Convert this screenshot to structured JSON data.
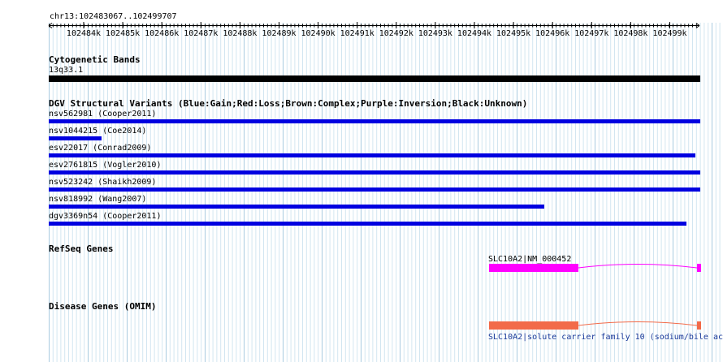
{
  "ruler": {
    "location": "chr13:102483067..102499707",
    "ticks": [
      "102484k",
      "102485k",
      "102486k",
      "102487k",
      "102488k",
      "102489k",
      "102490k",
      "102491k",
      "102492k",
      "102493k",
      "102494k",
      "102495k",
      "102496k",
      "102497k",
      "102498k",
      "102499k"
    ]
  },
  "tracks": {
    "cytoband": {
      "title": "Cytogenetic Bands",
      "band_label": "13q33.1",
      "band_color": "#000000"
    },
    "dgv": {
      "title": "DGV Structural Variants (Blue:Gain;Red:Loss;Brown:Complex;Purple:Inversion;Black:Unknown)",
      "gain_color": "#0000e0",
      "variants": [
        {
          "label": "nsv562981 (Cooper2011)"
        },
        {
          "label": "nsv1044215 (Coe2014)"
        },
        {
          "label": "esv22017 (Conrad2009)"
        },
        {
          "label": "esv2761815 (Vogler2010)"
        },
        {
          "label": "nsv523242 (Shaikh2009)"
        },
        {
          "label": "nsv818992 (Wang2007)"
        },
        {
          "label": "dgv3369n54 (Cooper2011)"
        }
      ]
    },
    "refseq": {
      "title": "RefSeq Genes",
      "gene_label": "SLC10A2|NM_000452",
      "color": "#ff00ff"
    },
    "disease": {
      "title": "Disease Genes (OMIM)",
      "gene_label": "SLC10A2|solute carrier family 10 (sodium/bile ac",
      "color": "#f26b4a",
      "label_color": "#1a3a9a"
    }
  }
}
